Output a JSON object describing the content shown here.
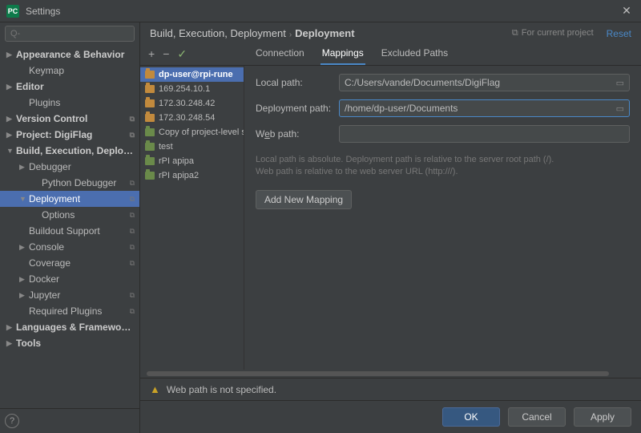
{
  "window": {
    "title": "Settings"
  },
  "search": {
    "placeholder": "Q-"
  },
  "sidebar": {
    "items": [
      {
        "label": "Appearance & Behavior",
        "bold": true,
        "arrow": "▶"
      },
      {
        "label": "Keymap",
        "indent": 1
      },
      {
        "label": "Editor",
        "bold": true,
        "arrow": "▶"
      },
      {
        "label": "Plugins",
        "indent": 1
      },
      {
        "label": "Version Control",
        "bold": true,
        "arrow": "▶",
        "pin": true
      },
      {
        "label": "Project: DigiFlag",
        "bold": true,
        "arrow": "▶",
        "pin": true
      },
      {
        "label": "Build, Execution, Deployment",
        "bold": true,
        "arrow": "▼"
      },
      {
        "label": "Debugger",
        "indent": 1,
        "arrow": "▶"
      },
      {
        "label": "Python Debugger",
        "indent": 2,
        "pin": true
      },
      {
        "label": "Deployment",
        "indent": 1,
        "arrow": "▼",
        "pin": true,
        "selected": true
      },
      {
        "label": "Options",
        "indent": 2,
        "pin": true
      },
      {
        "label": "Buildout Support",
        "indent": 1,
        "pin": true
      },
      {
        "label": "Console",
        "indent": 1,
        "arrow": "▶",
        "pin": true
      },
      {
        "label": "Coverage",
        "indent": 1,
        "pin": true
      },
      {
        "label": "Docker",
        "indent": 1,
        "arrow": "▶"
      },
      {
        "label": "Jupyter",
        "indent": 1,
        "arrow": "▶",
        "pin": true
      },
      {
        "label": "Required Plugins",
        "indent": 1,
        "pin": true
      },
      {
        "label": "Languages & Frameworks",
        "bold": true,
        "arrow": "▶"
      },
      {
        "label": "Tools",
        "bold": true,
        "arrow": "▶"
      }
    ]
  },
  "breadcrumb": {
    "a": "Build, Execution, Deployment",
    "b": "Deployment"
  },
  "scope": "For current project",
  "reset": "Reset",
  "toolbar": {
    "add": "+",
    "remove": "−",
    "check": "✓"
  },
  "tabs": [
    "Connection",
    "Mappings",
    "Excluded Paths"
  ],
  "servers": [
    {
      "label": "dp-user@rpi-rune",
      "selected": true,
      "bold": true,
      "icon": "sftp"
    },
    {
      "label": "169.254.10.1",
      "icon": "sftp"
    },
    {
      "label": "172.30.248.42",
      "icon": "sftp"
    },
    {
      "label": "172.30.248.54",
      "icon": "sftp"
    },
    {
      "label": "Copy of project-level serv",
      "icon": "generic"
    },
    {
      "label": "test",
      "icon": "generic"
    },
    {
      "label": "rPI apipa",
      "icon": "generic"
    },
    {
      "label": "rPI apipa2",
      "icon": "generic"
    }
  ],
  "form": {
    "local_label": "Local path:",
    "local_value": "C:/Users/vande/Documents/DigiFlag",
    "deploy_label": "Deployment path:",
    "deploy_value": "/home/dp-user/Documents",
    "web_label_pre": "W",
    "web_label_ul": "e",
    "web_label_post": "b path:",
    "web_value": "",
    "hint1": "Local path is absolute. Deployment path is relative to the server root path (/).",
    "hint2": "Web path is relative to the web server URL (http:///).",
    "add_mapping": "Add New Mapping"
  },
  "warning": "Web path is not specified.",
  "buttons": {
    "ok": "OK",
    "cancel": "Cancel",
    "apply": "Apply"
  }
}
